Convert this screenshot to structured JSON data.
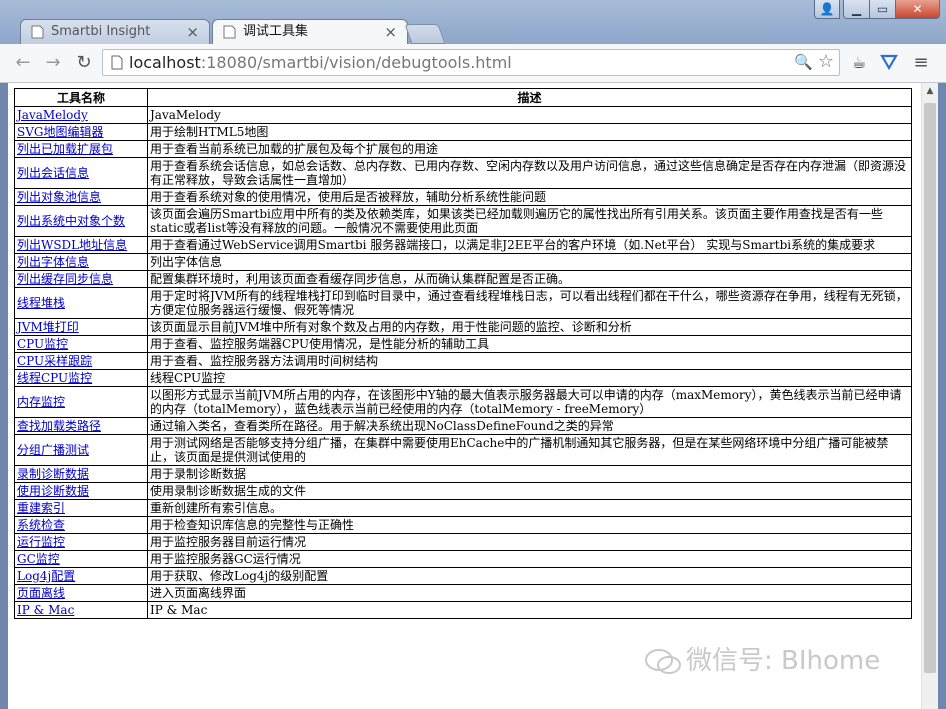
{
  "browser": {
    "tabs": [
      {
        "title": "Smartbi Insight",
        "active": false
      },
      {
        "title": "调试工具集",
        "active": true
      }
    ],
    "url_host": "localhost",
    "url_port": ":18080",
    "url_path": "/smartbi/vision/debugtools.html",
    "accent_color": "#2d6fd1"
  },
  "table": {
    "headers": {
      "name": "工具名称",
      "desc": "描述"
    },
    "rows": [
      {
        "name": "JavaMelody",
        "desc": "JavaMelody"
      },
      {
        "name": "SVG地图编辑器",
        "desc": "用于绘制HTML5地图"
      },
      {
        "name": "列出已加载扩展包",
        "desc": "用于查看当前系统已加载的扩展包及每个扩展包的用途"
      },
      {
        "name": "列出会话信息",
        "desc": "用于查看系统会话信息，如总会话数、总内存数、已用内存数、空闲内存数以及用户访问信息，通过这些信息确定是否存在内存泄漏（即资源没有正常释放，导致会话属性一直增加）"
      },
      {
        "name": "列出对象池信息",
        "desc": "用于查看系统对象的使用情况，使用后是否被释放，辅助分析系统性能问题"
      },
      {
        "name": "列出系统中对象个数",
        "desc": "该页面会遍历Smartbi应用中所有的类及依赖类库，如果该类已经加载则遍历它的属性找出所有引用关系。该页面主要作用查找是否有一些static或者list等没有释放的问题。一般情况不需要使用此页面"
      },
      {
        "name": "列出WSDL地址信息",
        "desc": "用于查看通过WebService调用Smartbi 服务器端接口，以满足非J2EE平台的客户环境（如.Net平台） 实现与Smartbi系统的集成要求"
      },
      {
        "name": "列出字体信息",
        "desc": "列出字体信息"
      },
      {
        "name": "列出缓存同步信息",
        "desc": "配置集群环境时，利用该页面查看缓存同步信息，从而确认集群配置是否正确。"
      },
      {
        "name": "线程堆栈",
        "desc": "用于定时将JVM所有的线程堆栈打印到临时目录中，通过查看线程堆栈日志，可以看出线程们都在干什么，哪些资源存在争用，线程有无死锁，方便定位服务器运行缓慢、假死等情况"
      },
      {
        "name": "JVM堆打印",
        "desc": "该页面显示目前JVM堆中所有对象个数及占用的内存数，用于性能问题的监控、诊断和分析"
      },
      {
        "name": "CPU监控",
        "desc": "用于查看、监控服务端器CPU使用情况，是性能分析的辅助工具"
      },
      {
        "name": "CPU采样跟踪",
        "desc": "用于查看、监控服务器方法调用时间树结构"
      },
      {
        "name": "线程CPU监控",
        "desc": "线程CPU监控"
      },
      {
        "name": "内存监控",
        "desc": "以图形方式显示当前JVM所占用的内存，在该图形中Y轴的最大值表示服务器最大可以申请的内存（maxMemory），黄色线表示当前已经申请的内存（totalMemory），蓝色线表示当前已经使用的内存（totalMemory - freeMemory）"
      },
      {
        "name": "查找加载类路径",
        "desc": "通过输入类名，查看类所在路径。用于解决系统出现NoClassDefineFound之类的异常"
      },
      {
        "name": "分组广播测试",
        "desc": "用于测试网络是否能够支持分组广播，在集群中需要使用EhCache中的广播机制通知其它服务器，但是在某些网络环境中分组广播可能被禁止，该页面是提供测试使用的"
      },
      {
        "name": "录制诊断数据",
        "desc": "用于录制诊断数据"
      },
      {
        "name": "使用诊断数据",
        "desc": "使用录制诊断数据生成的文件"
      },
      {
        "name": "重建索引",
        "desc": "重新创建所有索引信息。"
      },
      {
        "name": "系统检查",
        "desc": "用于检查知识库信息的完整性与正确性"
      },
      {
        "name": "运行监控",
        "desc": "用于监控服务器目前运行情况"
      },
      {
        "name": "GC监控",
        "desc": "用于监控服务器GC运行情况"
      },
      {
        "name": "Log4j配置",
        "desc": "用于获取、修改Log4j的级别配置"
      },
      {
        "name": "页面离线",
        "desc": "进入页面离线界面"
      },
      {
        "name": "IP & Mac",
        "desc": "IP & Mac"
      }
    ]
  },
  "watermark": {
    "text": "微信号: BIhome"
  }
}
